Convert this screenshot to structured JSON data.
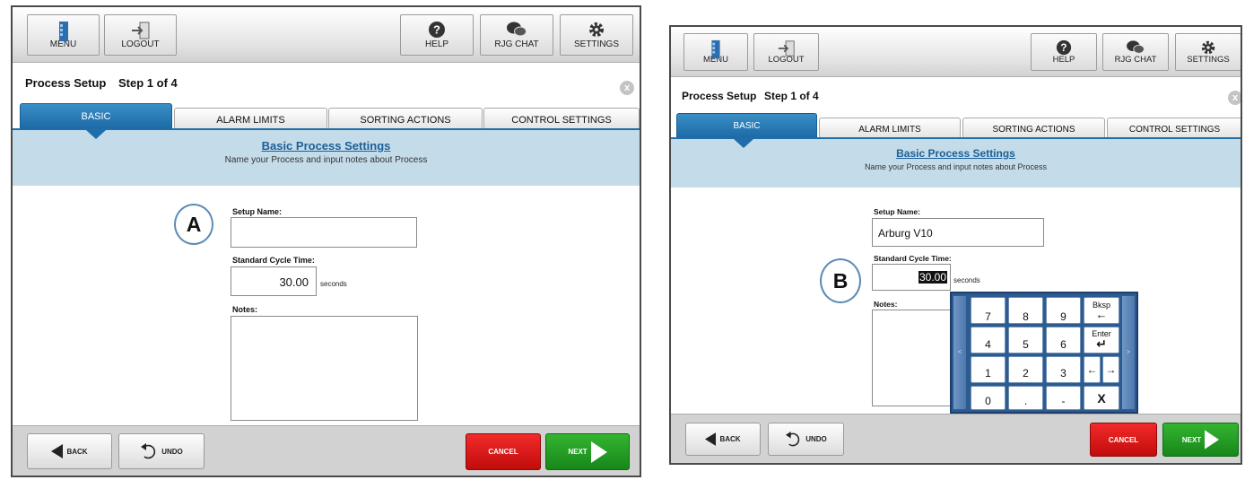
{
  "topbar": {
    "menu_label": "MENU",
    "logout_label": "LOGOUT",
    "help_label": "HELP",
    "chat_label": "RJG CHAT",
    "settings_label": "SETTINGS"
  },
  "page": {
    "title": "Process Setup",
    "step": "Step 1 of 4",
    "close_glyph": "x"
  },
  "tabs": [
    {
      "label": "BASIC",
      "active": true
    },
    {
      "label": "ALARM LIMITS",
      "active": false
    },
    {
      "label": "SORTING ACTIONS",
      "active": false
    },
    {
      "label": "CONTROL SETTINGS",
      "active": false
    }
  ],
  "section": {
    "title": "Basic Process Settings",
    "subtitle": "Name your Process and input notes about Process"
  },
  "form": {
    "setup_name_label": "Setup Name:",
    "cycle_time_label": "Standard Cycle Time:",
    "cycle_time_unit": "seconds",
    "notes_label": "Notes:"
  },
  "screen_a": {
    "callout": "A",
    "setup_name_value": "",
    "cycle_time_value": "30.00",
    "notes_value": ""
  },
  "screen_b": {
    "callout": "B",
    "setup_name_value": "Arburg V10",
    "cycle_time_value": "30.00"
  },
  "keypad": {
    "digits": [
      "7",
      "8",
      "9",
      "4",
      "5",
      "6",
      "1",
      "2",
      "3",
      "0",
      ".",
      "-"
    ],
    "backspace_label": "Bksp",
    "backspace_glyph": "←",
    "enter_label": "Enter",
    "enter_glyph": "↵",
    "left_glyph": "←",
    "right_glyph": "→",
    "close_glyph": "X",
    "scroll_left": "<",
    "scroll_right": ">"
  },
  "bottombar": {
    "back_label": "BACK",
    "undo_label": "UNDO",
    "cancel_label": "CANCEL",
    "next_label": "NEXT"
  },
  "colors": {
    "accent_blue": "#1f6ea9",
    "header_band": "#c4dcea",
    "cancel_red": "#d81818",
    "next_green": "#1f9a22",
    "keypad_blue": "#2d5a8f"
  }
}
